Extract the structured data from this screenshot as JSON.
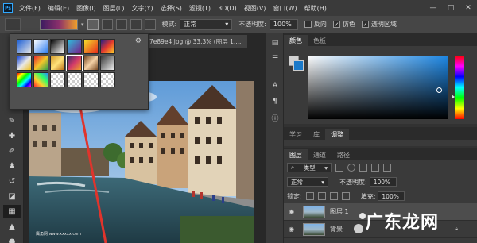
{
  "menubar": {
    "logo": "Ps",
    "items": [
      "文件(F)",
      "编辑(E)",
      "图像(I)",
      "图层(L)",
      "文字(Y)",
      "选择(S)",
      "滤镜(T)",
      "3D(D)",
      "视图(V)",
      "窗口(W)",
      "帮助(H)"
    ],
    "controls": [
      "—",
      "□",
      "✕"
    ]
  },
  "options": {
    "mode_label": "模式:",
    "mode_value": "正常",
    "opacity_label": "不透明度:",
    "opacity_value": "100%",
    "reverse_label": "反向",
    "dither_label": "仿色",
    "transparency_label": "透明区域"
  },
  "document": {
    "tab_title": "7e89e4.jpg @ 33.3% (图层 1,...",
    "photo_watermark": "鹰角网 www.xxxxx.com"
  },
  "color_panel": {
    "tabs": [
      "颜色",
      "色板"
    ],
    "foreground": "#d2d2d2",
    "background": "#1a79c9",
    "hue": "#1e88e5"
  },
  "mid_tabs": [
    "学习",
    "库",
    "调整"
  ],
  "layers_panel": {
    "tabs": [
      "图层",
      "通道",
      "路径"
    ],
    "kind_filter": "类型",
    "blend_mode": "正常",
    "opacity_label": "不透明度:",
    "opacity_value": "100%",
    "lock_label": "锁定:",
    "fill_label": "填充:",
    "fill_value": "100%",
    "layers": [
      {
        "name": "图层 1",
        "active": true
      },
      {
        "name": "背景",
        "active": false
      }
    ]
  },
  "watermark": {
    "text": "广东龙网"
  },
  "icons": {
    "eye": "eye-icon",
    "lock": "lock-icon",
    "gear": "gear-icon"
  }
}
